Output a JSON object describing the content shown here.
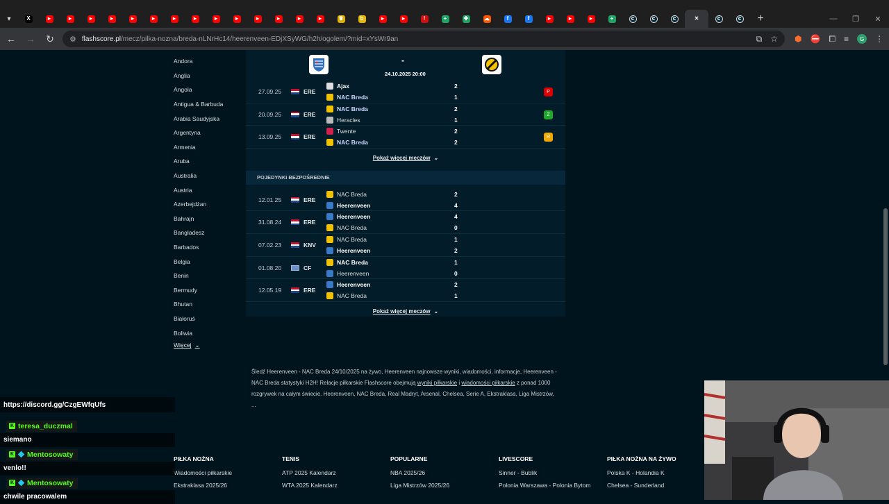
{
  "browser": {
    "tabs": [
      {
        "icon": "chevron-down-icon",
        "color": "#1f1f1f",
        "glyph": "▾"
      },
      {
        "icon": "x-twitter-icon",
        "color": "#000000",
        "glyph": "X"
      },
      {
        "icon": "youtube-icon",
        "color": "#ff0000",
        "glyph": "▸"
      },
      {
        "icon": "youtube-icon",
        "color": "#ff0000",
        "glyph": "▸"
      },
      {
        "icon": "youtube-icon",
        "color": "#ff0000",
        "glyph": "▸"
      },
      {
        "icon": "youtube-icon",
        "color": "#ff0000",
        "glyph": "▸"
      },
      {
        "icon": "youtube-icon",
        "color": "#ff0000",
        "glyph": "▸"
      },
      {
        "icon": "youtube-icon",
        "color": "#ff0000",
        "glyph": "▸"
      },
      {
        "icon": "youtube-icon",
        "color": "#ff0000",
        "glyph": "▸"
      },
      {
        "icon": "youtube-icon",
        "color": "#ff0000",
        "glyph": "▸"
      },
      {
        "icon": "youtube-icon",
        "color": "#ff0000",
        "glyph": "▸"
      },
      {
        "icon": "youtube-icon",
        "color": "#ff0000",
        "glyph": "▸"
      },
      {
        "icon": "youtube-icon",
        "color": "#ff0000",
        "glyph": "▸"
      },
      {
        "icon": "youtube-icon",
        "color": "#ff0000",
        "glyph": "▸"
      },
      {
        "icon": "youtube-icon",
        "color": "#ff0000",
        "glyph": "▸"
      },
      {
        "icon": "youtube-icon",
        "color": "#ff0000",
        "glyph": "▸"
      },
      {
        "icon": "trophy-icon",
        "color": "#e0b000",
        "glyph": "♛"
      },
      {
        "icon": "bet-icon",
        "color": "#e6b800",
        "glyph": "b"
      },
      {
        "icon": "youtube-icon",
        "color": "#ff0000",
        "glyph": "▸"
      },
      {
        "icon": "youtube-icon",
        "color": "#ff0000",
        "glyph": "▸"
      },
      {
        "icon": "exclamation-icon",
        "color": "#d01010",
        "glyph": "!"
      },
      {
        "icon": "sheets-plus-icon",
        "color": "#1fa463",
        "glyph": "+"
      },
      {
        "icon": "plus-icon",
        "color": "#1fa463",
        "glyph": "✚"
      },
      {
        "icon": "soundcloud-icon",
        "color": "#ff5500",
        "glyph": "☁"
      },
      {
        "icon": "facebook-icon",
        "color": "#1877f2",
        "glyph": "f"
      },
      {
        "icon": "facebook-icon",
        "color": "#1877f2",
        "glyph": "f"
      },
      {
        "icon": "youtube-icon",
        "color": "#ff0000",
        "glyph": "▸"
      },
      {
        "icon": "youtube-icon",
        "color": "#ff0000",
        "glyph": "▸"
      },
      {
        "icon": "youtube-icon",
        "color": "#ff0000",
        "glyph": "▸"
      },
      {
        "icon": "sheets-plus-icon",
        "color": "#1fa463",
        "glyph": "+"
      },
      {
        "icon": "flashscore-icon",
        "color": "#0a2a36",
        "glyph": "c"
      },
      {
        "icon": "flashscore-icon",
        "color": "#0a2a36",
        "glyph": "c"
      },
      {
        "icon": "flashscore-icon",
        "color": "#0a2a36",
        "glyph": "c"
      },
      {
        "icon": "close-icon",
        "color": "#35363a",
        "glyph": "✕",
        "active": true
      },
      {
        "icon": "flashscore-icon",
        "color": "#0a2a36",
        "glyph": "c"
      },
      {
        "icon": "flashscore-icon",
        "color": "#0a2a36",
        "glyph": "c"
      }
    ],
    "url_domain": "flashscore.pl",
    "url_path": "/mecz/pilka-nozna/breda-nLNrHc14/heerenveen-EDjXSyWG/h2h/ogolem/?mid=xYsWr9an"
  },
  "sidebar": {
    "countries": [
      "Andora",
      "Anglia",
      "Angola",
      "Antigua & Barbuda",
      "Arabia Saudyjska",
      "Argentyna",
      "Armenia",
      "Aruba",
      "Australia",
      "Austria",
      "Azerbejdżan",
      "Bahrajn",
      "Bangladesz",
      "Barbados",
      "Belgia",
      "Benin",
      "Bermudy",
      "Bhutan",
      "Białoruś",
      "Boliwia"
    ],
    "more_label": "Więcej"
  },
  "h2h": {
    "score_dash": "-",
    "match_date": "24.10.2025 20:00",
    "last_matches": [
      {
        "date": "27.09.25",
        "flag": "nl",
        "comp": "ERE",
        "home": "Ajax",
        "home_logo": "#dddddd",
        "away": "NAC Breda",
        "away_logo": "#f2c200",
        "home_goals": "2",
        "away_goals": "1",
        "winner": "home",
        "form": "P",
        "form_color": "#dc0000",
        "highlight": "away"
      },
      {
        "date": "20.09.25",
        "flag": "nl",
        "comp": "ERE",
        "home": "NAC Breda",
        "home_logo": "#f2c200",
        "away": "Heracles",
        "away_logo": "#bbbbbb",
        "home_goals": "2",
        "away_goals": "1",
        "winner": "home",
        "form": "Z",
        "form_color": "#1fa82b",
        "highlight": "home"
      },
      {
        "date": "13.09.25",
        "flag": "nl",
        "comp": "ERE",
        "home": "Twente",
        "home_logo": "#d0204c",
        "away": "NAC Breda",
        "away_logo": "#f2c200",
        "home_goals": "2",
        "away_goals": "2",
        "winner": "none",
        "form": "R",
        "form_color": "#f0a800",
        "highlight": "away"
      }
    ],
    "show_more_label": "Pokaż więcej meczów",
    "direct_section_title": "POJEDYNKI BEZPOŚREDNIE",
    "direct_matches": [
      {
        "date": "12.01.25",
        "flag": "nl",
        "comp": "ERE",
        "home": "NAC Breda",
        "home_logo": "#f2c200",
        "away": "Heerenveen",
        "away_logo": "#3a78c8",
        "home_goals": "2",
        "away_goals": "4",
        "winner": "away"
      },
      {
        "date": "31.08.24",
        "flag": "nl",
        "comp": "ERE",
        "home": "Heerenveen",
        "home_logo": "#3a78c8",
        "away": "NAC Breda",
        "away_logo": "#f2c200",
        "home_goals": "4",
        "away_goals": "0",
        "winner": "home"
      },
      {
        "date": "07.02.23",
        "flag": "nl",
        "comp": "KNV",
        "home": "NAC Breda",
        "home_logo": "#f2c200",
        "away": "Heerenveen",
        "away_logo": "#3a78c8",
        "home_goals": "1",
        "away_goals": "2",
        "winner": "away"
      },
      {
        "date": "01.08.20",
        "flag": "world",
        "comp": "CF",
        "home": "NAC Breda",
        "home_logo": "#f2c200",
        "away": "Heerenveen",
        "away_logo": "#3a78c8",
        "home_goals": "1",
        "away_goals": "0",
        "winner": "home"
      },
      {
        "date": "12.05.19",
        "flag": "nl",
        "comp": "ERE",
        "home": "Heerenveen",
        "home_logo": "#3a78c8",
        "away": "NAC Breda",
        "away_logo": "#f2c200",
        "home_goals": "2",
        "away_goals": "1",
        "winner": "home"
      }
    ]
  },
  "seo": {
    "text_1": "Śledź Heerenveen - NAC Breda 24/10/2025 na żywo, Heerenveen najnowsze wyniki, wiadomości, informacje, Heerenveen - NAC Breda statystyki H2H! Relacje piłkarskie Flashscore obejmują ",
    "link_1": "wyniki piłkarskie",
    "text_2": " i ",
    "link_2": "wiadomości piłkarskie",
    "text_3": " z ponad 1000 rozgrywek na całym świecie. Heerenveen, NAC Breda, Real Madryt, Arsenal, Chelsea, Serie A, Ekstraklasa, Liga Mistrzów, ..."
  },
  "footer": [
    {
      "title": "PIŁKA NOŻNA",
      "links": [
        "Wiadomości piłkarskie",
        "Ekstraklasa 2025/26"
      ]
    },
    {
      "title": "TENIS",
      "links": [
        "ATP 2025 Kalendarz",
        "WTA 2025 Kalendarz"
      ]
    },
    {
      "title": "POPULARNE",
      "links": [
        "NBA 2025/26",
        "Liga Mistrzów 2025/26"
      ]
    },
    {
      "title": "LIVESCORE",
      "links": [
        "Sinner - Bublik",
        "Polonia Warszawa - Polonia Bytom"
      ]
    },
    {
      "title": "PIŁKA NOŻNA NA ŻYWO",
      "links": [
        "Polska K - Holandia K",
        "Chelsea - Sunderland"
      ]
    }
  ],
  "chat": {
    "discord": "https://discord.gg/CzgEWfqUfs",
    "messages": [
      {
        "user": "teresa_duczmal",
        "text": "siemano"
      },
      {
        "user": "Mentosowaty",
        "text": "venlo!!"
      },
      {
        "user": "Mentosowaty",
        "text": "chwile pracowalem"
      }
    ]
  }
}
